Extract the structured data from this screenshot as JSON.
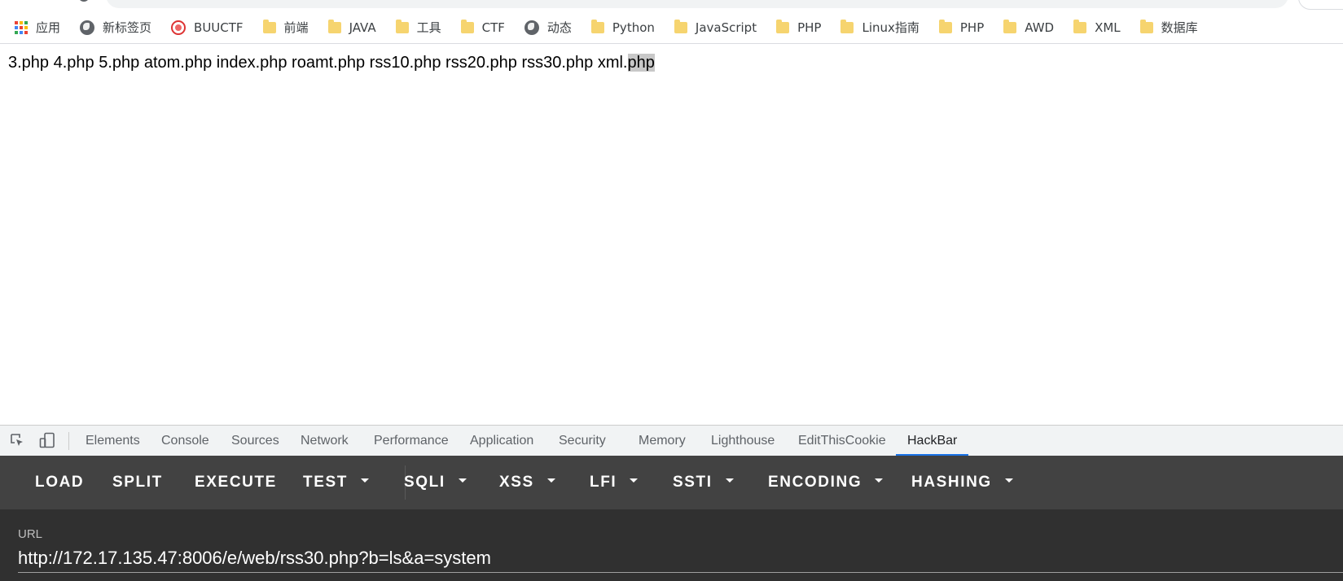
{
  "bookmarks": [
    {
      "label": "应用",
      "icon": "apps-icon"
    },
    {
      "label": "新标签页",
      "icon": "globe-icon"
    },
    {
      "label": "BUUCTF",
      "icon": "buuctf-icon"
    },
    {
      "label": "前端",
      "icon": "folder-icon"
    },
    {
      "label": "JAVA",
      "icon": "folder-icon"
    },
    {
      "label": "工具",
      "icon": "folder-icon"
    },
    {
      "label": "CTF",
      "icon": "folder-icon"
    },
    {
      "label": "动态",
      "icon": "globe-icon"
    },
    {
      "label": "Python",
      "icon": "folder-icon"
    },
    {
      "label": "JavaScript",
      "icon": "folder-icon"
    },
    {
      "label": "PHP",
      "icon": "folder-icon"
    },
    {
      "label": "Linux指南",
      "icon": "folder-icon"
    },
    {
      "label": "PHP",
      "icon": "folder-icon"
    },
    {
      "label": "AWD",
      "icon": "folder-icon"
    },
    {
      "label": "XML",
      "icon": "folder-icon"
    },
    {
      "label": "数据库",
      "icon": "folder-icon"
    }
  ],
  "page": {
    "output": "3.php 4.php 5.php atom.php index.php roamt.php rss10.php rss20.php rss30.php xml.",
    "selected": "php"
  },
  "devtools": {
    "tabs": [
      "Elements",
      "Console",
      "Sources",
      "Network",
      "Performance",
      "Application",
      "Security",
      "Memory",
      "Lighthouse",
      "EditThisCookie",
      "HackBar"
    ],
    "active_tab": "HackBar",
    "active_color": "#1a73e8"
  },
  "hackbar": {
    "buttons": [
      {
        "label": "LOAD",
        "dropdown": false
      },
      {
        "label": "SPLIT",
        "dropdown": false
      },
      {
        "label": "EXECUTE",
        "dropdown": false
      },
      {
        "label": "TEST",
        "dropdown": true
      },
      {
        "label": "SQLI",
        "dropdown": true
      },
      {
        "label": "XSS",
        "dropdown": true
      },
      {
        "label": "LFI",
        "dropdown": true
      },
      {
        "label": "SSTI",
        "dropdown": true
      },
      {
        "label": "ENCODING",
        "dropdown": true
      },
      {
        "label": "HASHING",
        "dropdown": true
      }
    ],
    "url_label": "URL",
    "url_value": "http://172.17.135.47:8006/e/web/rss30.php?b=ls&a=system"
  },
  "colors": {
    "toolbar_bg": "#424242",
    "url_panel_bg": "#303030",
    "selection_bg": "#c8c8c8"
  }
}
